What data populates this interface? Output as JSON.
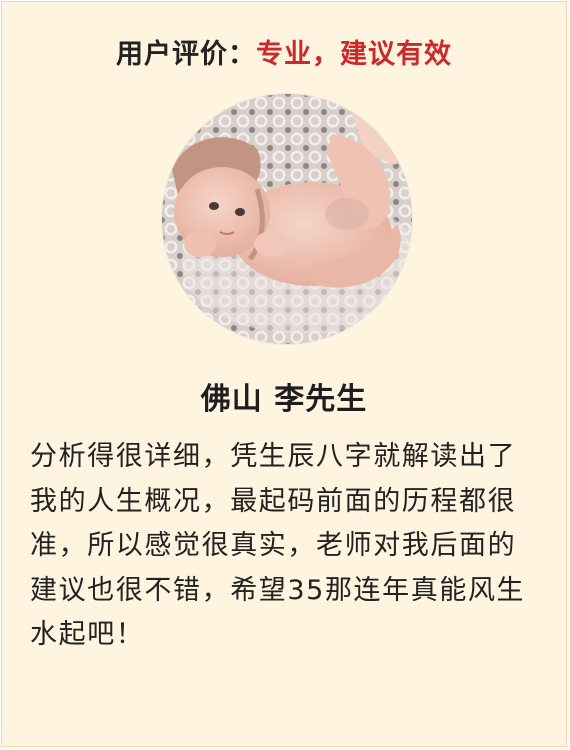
{
  "header": {
    "prefix": "用户评价",
    "colon": "：",
    "highlight": "专业，建议有效"
  },
  "avatar": {
    "alt": "baby-photo",
    "colors": {
      "blanket": "#d9d2d0",
      "skin": "#f1c7b8",
      "hat": "#c29482"
    }
  },
  "reviewer": {
    "name": "佛山 李先生"
  },
  "review": {
    "text": "分析得很详细，凭生辰八字就解读出了我的人生概况，最起码前面的历程都很准，所以感觉很真实，老师对我后面的建议也很不错，希望35那连年真能风生水起吧！"
  },
  "colors": {
    "background": "#fff4df",
    "border": "#f2d7a3",
    "accent": "#cc2a2a",
    "text": "#222222"
  }
}
